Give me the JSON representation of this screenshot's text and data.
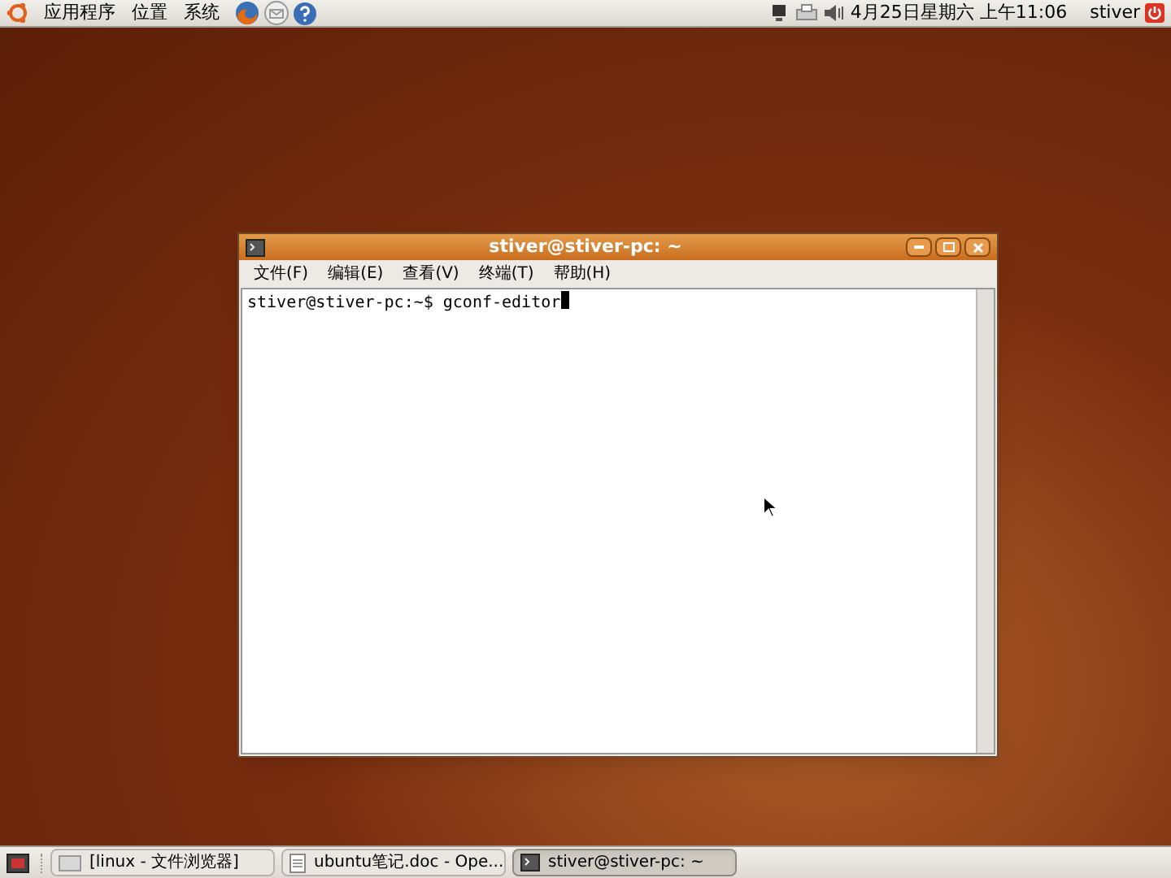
{
  "top_panel": {
    "menus": [
      "应用程序",
      "位置",
      "系统"
    ],
    "clock": "4月25日星期六 上午11:06",
    "user": "stiver"
  },
  "terminal": {
    "title": "stiver@stiver-pc: ~",
    "menu": [
      "文件(F)",
      "编辑(E)",
      "查看(V)",
      "终端(T)",
      "帮助(H)"
    ],
    "prompt": "stiver@stiver-pc:~$",
    "command": "gconf-editor"
  },
  "taskbar": [
    {
      "label": "[linux - 文件浏览器]",
      "kind": "folder",
      "selected": false
    },
    {
      "label": "ubuntu笔记.doc - Ope...",
      "kind": "document",
      "selected": false
    },
    {
      "label": "stiver@stiver-pc: ~",
      "kind": "terminal",
      "selected": true
    }
  ]
}
